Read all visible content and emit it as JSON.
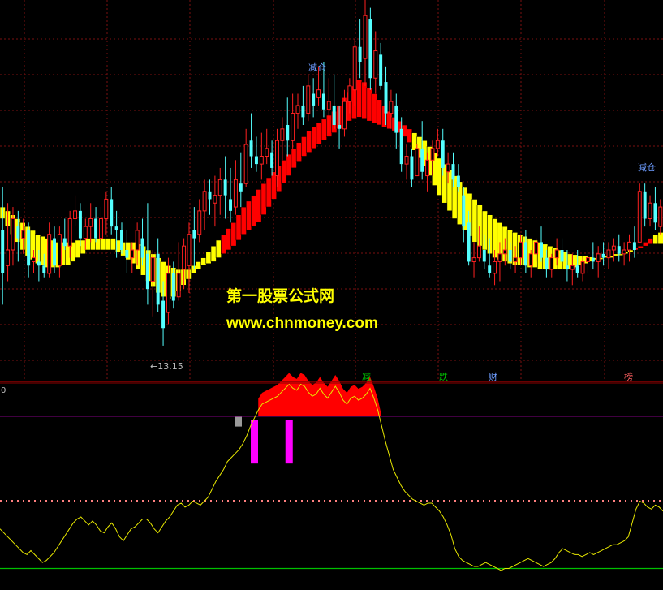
{
  "chart_data": [
    {
      "type": "candlestick",
      "panel": "price",
      "ylim": [
        12.4,
        22.0
      ],
      "up_color": "#ff2020",
      "down_color": "#54ffff",
      "candles": [
        [
          16.1,
          17.2,
          14.2,
          15.0
        ],
        [
          15.2,
          16.8,
          14.8,
          15.6
        ],
        [
          15.6,
          16.7,
          15.2,
          16.4
        ],
        [
          16.2,
          16.6,
          15.3,
          15.9
        ],
        [
          15.9,
          16.4,
          15.5,
          16.1
        ],
        [
          16.1,
          16.3,
          14.9,
          15.2
        ],
        [
          15.3,
          15.6,
          15.0,
          15.4
        ],
        [
          15.3,
          15.6,
          14.8,
          15.2
        ],
        [
          15.2,
          15.5,
          14.9,
          15.0
        ],
        [
          15.0,
          16.3,
          14.9,
          16.0
        ],
        [
          15.9,
          16.2,
          15.0,
          15.2
        ],
        [
          15.2,
          16.2,
          14.9,
          16.0
        ],
        [
          15.9,
          16.4,
          15.6,
          15.7
        ],
        [
          15.7,
          16.6,
          15.4,
          16.4
        ],
        [
          16.4,
          17.0,
          16.2,
          16.6
        ],
        [
          16.6,
          16.8,
          15.7,
          15.9
        ],
        [
          15.9,
          16.4,
          15.6,
          16.2
        ],
        [
          16.2,
          16.8,
          15.8,
          16.4
        ],
        [
          16.4,
          16.7,
          15.8,
          15.9
        ],
        [
          15.9,
          16.7,
          15.6,
          16.4
        ],
        [
          16.4,
          17.1,
          16.0,
          16.9
        ],
        [
          16.9,
          17.2,
          16.0,
          16.2
        ],
        [
          16.2,
          16.6,
          15.4,
          16.1
        ],
        [
          16.1,
          16.3,
          15.5,
          15.6
        ],
        [
          15.6,
          16.1,
          15.0,
          15.4
        ],
        [
          15.4,
          15.8,
          15.0,
          15.6
        ],
        [
          15.6,
          16.3,
          15.2,
          16.1
        ],
        [
          15.9,
          16.4,
          15.2,
          15.4
        ],
        [
          15.5,
          16.8,
          14.2,
          14.6
        ],
        [
          14.8,
          15.6,
          13.9,
          15.4
        ],
        [
          15.5,
          15.9,
          14.0,
          14.2
        ],
        [
          14.3,
          14.8,
          13.15,
          13.6
        ],
        [
          14.0,
          15.4,
          13.7,
          15.0
        ],
        [
          15.0,
          15.3,
          14.1,
          14.3
        ],
        [
          14.4,
          15.8,
          14.3,
          15.0
        ],
        [
          15.1,
          15.9,
          14.6,
          15.7
        ],
        [
          15.2,
          16.3,
          14.5,
          16.0
        ],
        [
          16.1,
          16.7,
          15.1,
          15.9
        ],
        [
          16.0,
          16.9,
          15.8,
          16.6
        ],
        [
          16.6,
          17.4,
          16.1,
          17.1
        ],
        [
          17.1,
          17.4,
          16.5,
          16.9
        ],
        [
          16.8,
          17.5,
          16.2,
          17.0
        ],
        [
          17.0,
          17.7,
          16.5,
          17.4
        ],
        [
          17.4,
          18.0,
          16.4,
          17.0
        ],
        [
          16.9,
          17.7,
          16.3,
          16.6
        ],
        [
          16.7,
          17.9,
          16.5,
          17.4
        ],
        [
          17.3,
          18.1,
          16.7,
          17.1
        ],
        [
          17.3,
          18.7,
          17.2,
          18.3
        ],
        [
          18.4,
          19.1,
          17.7,
          18.0
        ],
        [
          18.0,
          18.5,
          17.6,
          17.8
        ],
        [
          17.8,
          18.6,
          17.4,
          18.0
        ],
        [
          18.0,
          18.7,
          17.8,
          18.2
        ],
        [
          18.1,
          18.4,
          17.5,
          17.7
        ],
        [
          17.5,
          18.7,
          17.2,
          18.4
        ],
        [
          18.4,
          19.0,
          17.9,
          18.7
        ],
        [
          18.8,
          19.5,
          18.0,
          18.4
        ],
        [
          18.4,
          19.6,
          18.2,
          19.1
        ],
        [
          19.1,
          19.6,
          18.7,
          19.3
        ],
        [
          19.3,
          19.8,
          18.8,
          19.0
        ],
        [
          19.1,
          20.1,
          18.9,
          19.8
        ],
        [
          19.6,
          20.0,
          19.0,
          19.3
        ],
        [
          19.5,
          20.3,
          19.3,
          19.7
        ],
        [
          19.6,
          20.4,
          19.0,
          19.2
        ],
        [
          19.2,
          20.0,
          18.6,
          19.4
        ],
        [
          19.3,
          20.1,
          18.7,
          18.8
        ],
        [
          18.8,
          19.3,
          18.2,
          18.7
        ],
        [
          18.7,
          19.7,
          18.5,
          19.4
        ],
        [
          19.4,
          20.0,
          19.1,
          19.8
        ],
        [
          19.7,
          21.0,
          19.3,
          20.8
        ],
        [
          20.8,
          21.5,
          20.0,
          20.4
        ],
        [
          20.5,
          22.0,
          19.8,
          21.6
        ],
        [
          21.5,
          21.8,
          19.7,
          20.0
        ],
        [
          20.0,
          21.2,
          19.6,
          20.7
        ],
        [
          20.6,
          20.9,
          19.7,
          19.8
        ],
        [
          19.9,
          20.3,
          18.8,
          19.1
        ],
        [
          19.1,
          19.7,
          18.7,
          19.4
        ],
        [
          19.3,
          19.6,
          18.2,
          18.6
        ],
        [
          18.7,
          19.0,
          17.6,
          17.8
        ],
        [
          17.8,
          18.3,
          17.4,
          18.0
        ],
        [
          18.0,
          18.2,
          17.2,
          17.4
        ],
        [
          17.5,
          18.3,
          17.5,
          18.2
        ],
        [
          18.2,
          18.9,
          17.4,
          17.6
        ],
        [
          17.5,
          18.1,
          17.1,
          17.9
        ],
        [
          17.9,
          18.4,
          17.5,
          18.2
        ],
        [
          18.2,
          18.7,
          18.0,
          18.4
        ],
        [
          18.4,
          18.7,
          17.5,
          17.7
        ],
        [
          17.6,
          18.1,
          17.3,
          17.8
        ],
        [
          17.8,
          18.1,
          17.2,
          17.4
        ],
        [
          17.5,
          17.8,
          17.1,
          17.2
        ],
        [
          17.0,
          17.2,
          15.8,
          16.2
        ],
        [
          16.3,
          16.6,
          15.2,
          15.3
        ],
        [
          15.3,
          15.8,
          14.9,
          15.4
        ],
        [
          15.4,
          16.2,
          15.3,
          15.7
        ],
        [
          15.6,
          16.0,
          15.1,
          15.3
        ],
        [
          15.2,
          15.9,
          14.9,
          15.0
        ],
        [
          15.0,
          15.6,
          14.7,
          15.3
        ],
        [
          15.3,
          15.8,
          14.8,
          15.5
        ],
        [
          15.5,
          15.9,
          15.2,
          15.6
        ],
        [
          15.6,
          15.8,
          15.1,
          15.3
        ],
        [
          15.3,
          15.7,
          15.0,
          15.4
        ],
        [
          15.4,
          16.0,
          15.2,
          15.8
        ],
        [
          15.8,
          16.1,
          15.0,
          15.2
        ],
        [
          15.2,
          15.6,
          14.9,
          15.5
        ],
        [
          15.5,
          15.9,
          15.3,
          15.8
        ],
        [
          15.8,
          16.2,
          15.3,
          15.4
        ],
        [
          15.4,
          15.6,
          14.9,
          15.1
        ],
        [
          15.1,
          15.5,
          14.9,
          15.4
        ],
        [
          15.4,
          15.9,
          15.2,
          15.6
        ],
        [
          15.6,
          15.9,
          15.2,
          15.3
        ],
        [
          15.2,
          15.6,
          14.8,
          15.1
        ],
        [
          15.1,
          15.5,
          14.7,
          15.2
        ],
        [
          15.2,
          15.6,
          14.9,
          15.0
        ],
        [
          15.0,
          15.4,
          14.8,
          15.3
        ],
        [
          15.3,
          15.6,
          15.0,
          15.4
        ],
        [
          15.4,
          15.8,
          15.1,
          15.3
        ],
        [
          15.3,
          15.7,
          14.9,
          15.5
        ],
        [
          15.5,
          15.8,
          15.2,
          15.4
        ],
        [
          15.4,
          15.8,
          15.1,
          15.6
        ],
        [
          15.6,
          15.9,
          15.3,
          15.7
        ],
        [
          15.7,
          16.0,
          15.3,
          15.5
        ],
        [
          15.5,
          15.8,
          15.2,
          15.6
        ],
        [
          15.6,
          16.0,
          15.3,
          15.8
        ],
        [
          15.8,
          16.2,
          15.4,
          15.6
        ],
        [
          15.8,
          17.3,
          15.8,
          17.1
        ],
        [
          17.1,
          17.3,
          16.2,
          16.4
        ],
        [
          16.4,
          17.0,
          16.2,
          16.8
        ],
        [
          16.8,
          17.2,
          16.1,
          16.3
        ],
        [
          16.2,
          16.9,
          16.0,
          16.7
        ]
      ]
    },
    {
      "type": "band",
      "panel": "price",
      "ylim": [
        12.4,
        22.0
      ],
      "colors": {
        "rising": "#ff0000",
        "falling": "#ffff00"
      },
      "upper": [
        16.7,
        16.6,
        16.5,
        16.4,
        16.3,
        16.2,
        16.1,
        16.0,
        15.95,
        15.9,
        15.85,
        15.8,
        15.8,
        15.8,
        15.8,
        15.85,
        15.85,
        15.9,
        15.9,
        15.9,
        15.9,
        15.9,
        15.9,
        15.85,
        15.8,
        15.8,
        15.8,
        15.75,
        15.7,
        15.6,
        15.5,
        15.4,
        15.3,
        15.2,
        15.15,
        15.1,
        15.1,
        15.1,
        15.2,
        15.3,
        15.4,
        15.55,
        15.7,
        15.85,
        16.0,
        16.15,
        16.3,
        16.5,
        16.7,
        16.85,
        17.0,
        17.15,
        17.3,
        17.45,
        17.6,
        17.75,
        17.9,
        18.05,
        18.2,
        18.35,
        18.5,
        18.65,
        18.75,
        18.85,
        18.95,
        19.05,
        19.15,
        19.3,
        19.5,
        19.65,
        19.8,
        19.95,
        19.9,
        19.75,
        19.6,
        19.45,
        19.3,
        19.15,
        19.0,
        18.9,
        18.8,
        18.7,
        18.6,
        18.5,
        18.4,
        18.25,
        18.1,
        17.95,
        17.8,
        17.65,
        17.5,
        17.35,
        17.2,
        17.05,
        16.9,
        16.75,
        16.6,
        16.5,
        16.4,
        16.3,
        16.2,
        16.12,
        16.05,
        16.0,
        15.95,
        15.9,
        15.85,
        15.8,
        15.75,
        15.7,
        15.65,
        15.6,
        15.55,
        15.5,
        15.48,
        15.46,
        15.44,
        15.42,
        15.4,
        15.4,
        15.4,
        15.4,
        15.45,
        15.5,
        15.55,
        15.6,
        15.65,
        15.7,
        15.8,
        15.9,
        16.0,
        16.05
      ],
      "lower": [
        16.4,
        16.2,
        16.0,
        15.8,
        15.6,
        15.45,
        15.35,
        15.25,
        15.2,
        15.15,
        15.15,
        15.15,
        15.2,
        15.2,
        15.3,
        15.4,
        15.5,
        15.6,
        15.6,
        15.6,
        15.6,
        15.6,
        15.6,
        15.55,
        15.45,
        15.35,
        15.25,
        15.1,
        14.95,
        14.8,
        14.65,
        14.5,
        14.4,
        14.35,
        14.4,
        14.55,
        14.7,
        14.85,
        15.0,
        15.1,
        15.2,
        15.25,
        15.3,
        15.4,
        15.5,
        15.6,
        15.7,
        15.85,
        16.0,
        16.1,
        16.2,
        16.3,
        16.5,
        16.7,
        16.9,
        17.1,
        17.3,
        17.5,
        17.7,
        17.85,
        18.0,
        18.1,
        18.2,
        18.3,
        18.4,
        18.5,
        18.6,
        18.7,
        18.8,
        18.9,
        18.95,
        19.0,
        18.95,
        18.9,
        18.85,
        18.8,
        18.75,
        18.7,
        18.65,
        18.6,
        18.5,
        18.35,
        18.15,
        17.95,
        17.75,
        17.5,
        17.25,
        17.0,
        16.8,
        16.6,
        16.4,
        16.25,
        16.1,
        15.95,
        15.8,
        15.7,
        15.6,
        15.5,
        15.4,
        15.35,
        15.3,
        15.25,
        15.2,
        15.2,
        15.2,
        15.15,
        15.15,
        15.1,
        15.1,
        15.1,
        15.1,
        15.1,
        15.1,
        15.1,
        15.15,
        15.2,
        15.25,
        15.3,
        15.35,
        15.4,
        15.45,
        15.45,
        15.5,
        15.5,
        15.5,
        15.55,
        15.6,
        15.65,
        15.7,
        15.75,
        15.75,
        15.75
      ],
      "rising_flags": [
        0,
        0,
        0,
        0,
        0,
        0,
        0,
        0,
        0,
        0,
        0,
        0,
        0,
        0,
        0,
        0,
        0,
        0,
        0,
        0,
        0,
        0,
        0,
        0,
        0,
        0,
        0,
        0,
        0,
        0,
        0,
        0,
        0,
        0,
        0,
        0,
        0,
        0,
        0,
        0,
        0,
        0,
        0,
        0,
        1,
        1,
        1,
        1,
        1,
        1,
        1,
        1,
        1,
        1,
        1,
        1,
        1,
        1,
        1,
        1,
        1,
        1,
        1,
        1,
        1,
        1,
        1,
        1,
        1,
        1,
        1,
        1,
        1,
        1,
        1,
        1,
        1,
        1,
        1,
        1,
        1,
        1,
        0,
        0,
        0,
        0,
        0,
        0,
        0,
        0,
        0,
        0,
        0,
        0,
        0,
        0,
        0,
        0,
        0,
        0,
        0,
        0,
        0,
        0,
        0,
        0,
        0,
        0,
        0,
        0,
        0,
        0,
        0,
        0,
        0,
        0,
        0,
        0,
        0,
        0,
        0,
        0,
        0,
        0,
        0,
        0,
        1,
        1,
        1,
        1
      ]
    },
    {
      "type": "area",
      "panel": "indicator",
      "ylim": [
        0,
        100
      ],
      "reference_lines": [
        {
          "value": 85,
          "color": "#ff00ff",
          "style": "solid"
        },
        {
          "value": 42,
          "color": "#ff7f7f",
          "style": "dotted"
        },
        {
          "value": 8,
          "color": "#00c000",
          "style": "solid"
        }
      ],
      "line_color": "#e8e800",
      "fill_color": "#ff0000",
      "fill_threshold": 85,
      "line": [
        28,
        26,
        24,
        22,
        20,
        18,
        16,
        15,
        17,
        15,
        13,
        11,
        12,
        14,
        16,
        19,
        22,
        25,
        28,
        31,
        33,
        34,
        32,
        30,
        32,
        30,
        27,
        26,
        29,
        31,
        28,
        24,
        22,
        25,
        28,
        29,
        31,
        33,
        33,
        31,
        28,
        26,
        29,
        32,
        34,
        37,
        40,
        41,
        39,
        40,
        42,
        41,
        40,
        42,
        44,
        48,
        52,
        55,
        58,
        62,
        64,
        66,
        68,
        71,
        75,
        80,
        84,
        88,
        91,
        92,
        93,
        94,
        95,
        97,
        99,
        101,
        99,
        98,
        101,
        100,
        97,
        95,
        96,
        99,
        96,
        94,
        97,
        100,
        97,
        93,
        91,
        94,
        95,
        93,
        94,
        96,
        99,
        94,
        88,
        80,
        72,
        65,
        58,
        54,
        50,
        47,
        45,
        43,
        42,
        41,
        40,
        41,
        41,
        39,
        37,
        34,
        30,
        25,
        18,
        14,
        12,
        11,
        10,
        9,
        9,
        10,
        11,
        10,
        9,
        8,
        7,
        8,
        8,
        9,
        10,
        11,
        12,
        13,
        12,
        11,
        10,
        9,
        10,
        11,
        13,
        16,
        18,
        17,
        16,
        15,
        15,
        14,
        15,
        16,
        15,
        16,
        17,
        18,
        19,
        20,
        20,
        21,
        22,
        24,
        31,
        38,
        42,
        41,
        39,
        38,
        40,
        39,
        37
      ]
    },
    {
      "type": "bar",
      "panel": "indicator",
      "ylim": [
        0,
        100
      ],
      "color": "#ff00ff",
      "bars": [
        {
          "index": 66,
          "value": 62
        },
        {
          "index": 75,
          "value": 62
        }
      ]
    }
  ],
  "labels": {
    "min_price": "←13.15",
    "reduce_1": "减仓",
    "reduce_2": "减仓",
    "zero": "0",
    "sig_reduce": "减",
    "sig_fall": "跌",
    "sig_wealth": "财",
    "sig_rank": "榜"
  },
  "watermark": {
    "line1": "第一股票公式网",
    "line2": "www.chnmoney.com"
  }
}
